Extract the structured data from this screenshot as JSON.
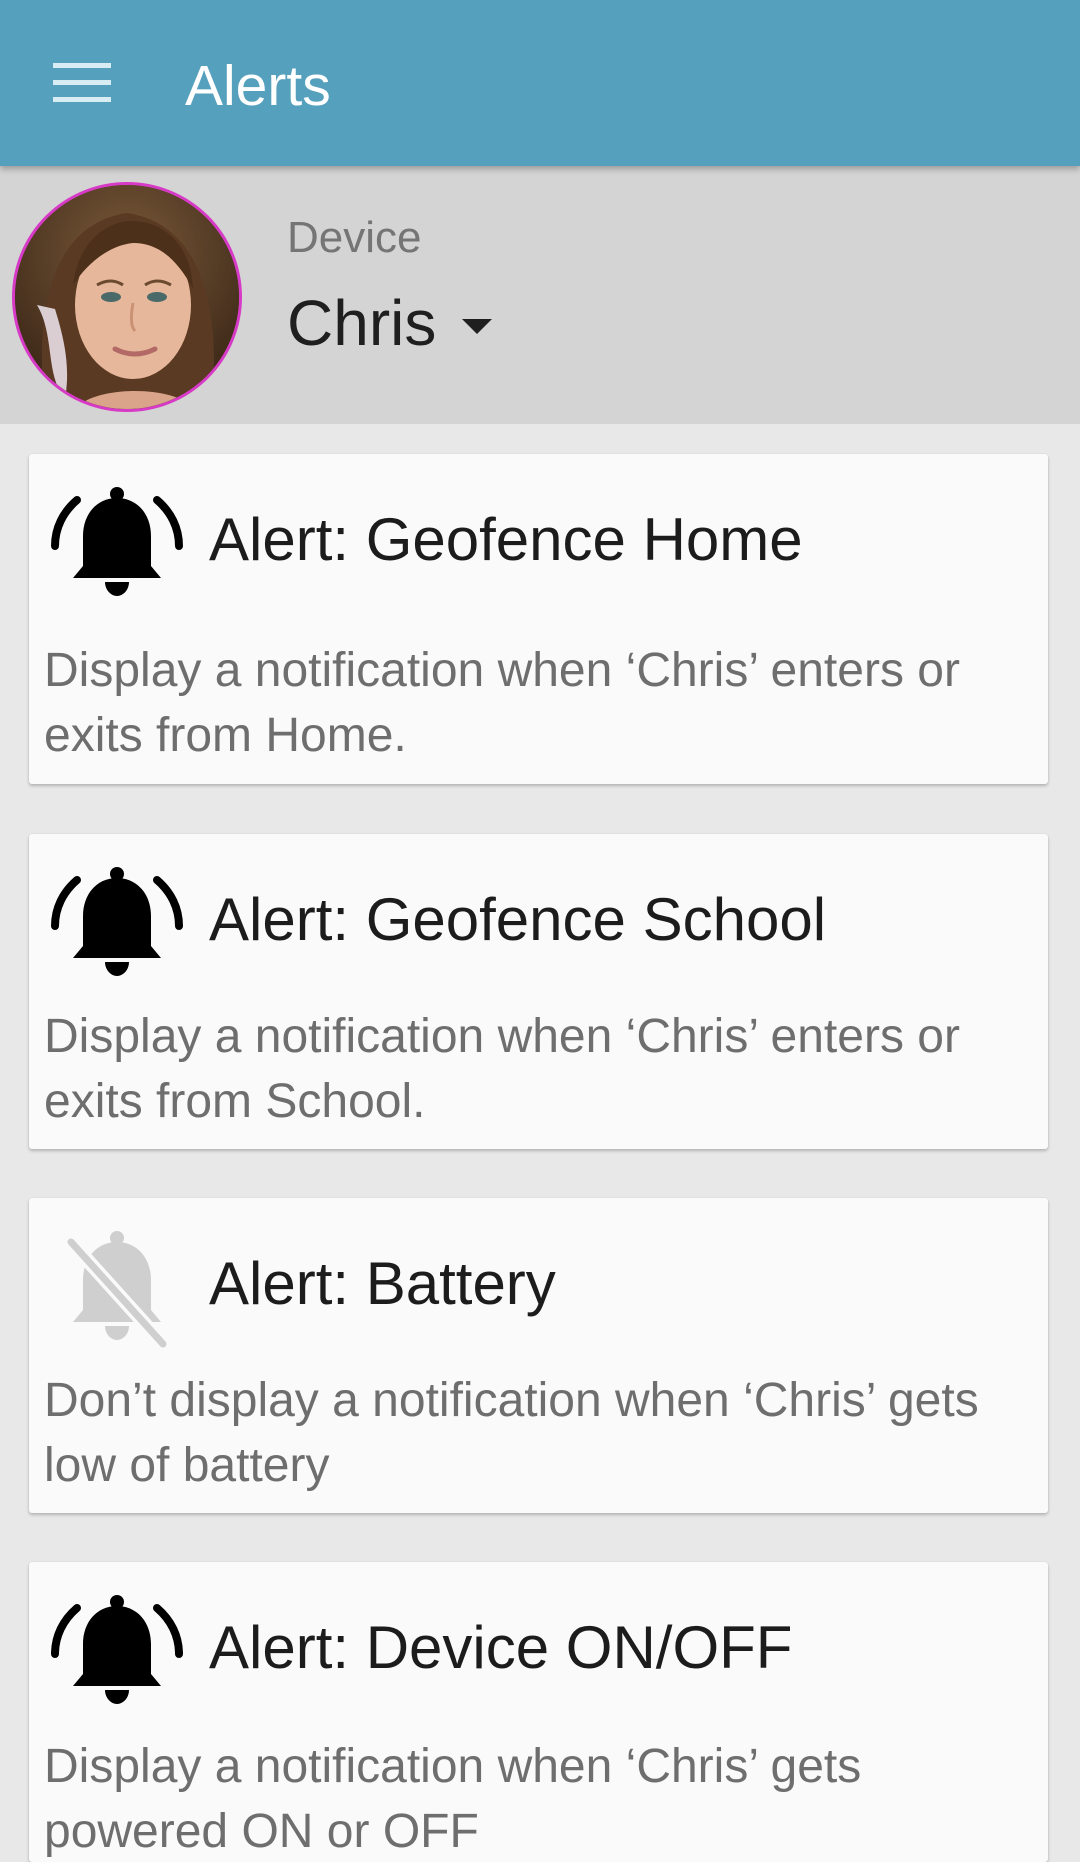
{
  "app_bar": {
    "title": "Alerts",
    "menu_icon": "hamburger-menu-icon",
    "background_color": "#55a0bd"
  },
  "device": {
    "label": "Device",
    "selected": "Chris",
    "dropdown_icon": "caret-down-icon",
    "avatar_ring_color": "#d63ac6"
  },
  "alerts": [
    {
      "title": "Alert: Geofence Home",
      "description": "Display a notification when ‘Chris’ enters or exits from Home.",
      "enabled": true,
      "icon": "bell-ringing-icon"
    },
    {
      "title": "Alert: Geofence School",
      "description": "Display a notification when ‘Chris’ enters or exits from School.",
      "enabled": true,
      "icon": "bell-ringing-icon"
    },
    {
      "title": "Alert: Battery",
      "description": "Don’t display a notification when ‘Chris’ gets low of battery",
      "enabled": false,
      "icon": "bell-off-icon"
    },
    {
      "title": "Alert: Device ON/OFF",
      "description": "Display a notification when ‘Chris’ gets powered ON or OFF",
      "enabled": true,
      "icon": "bell-ringing-icon"
    }
  ]
}
